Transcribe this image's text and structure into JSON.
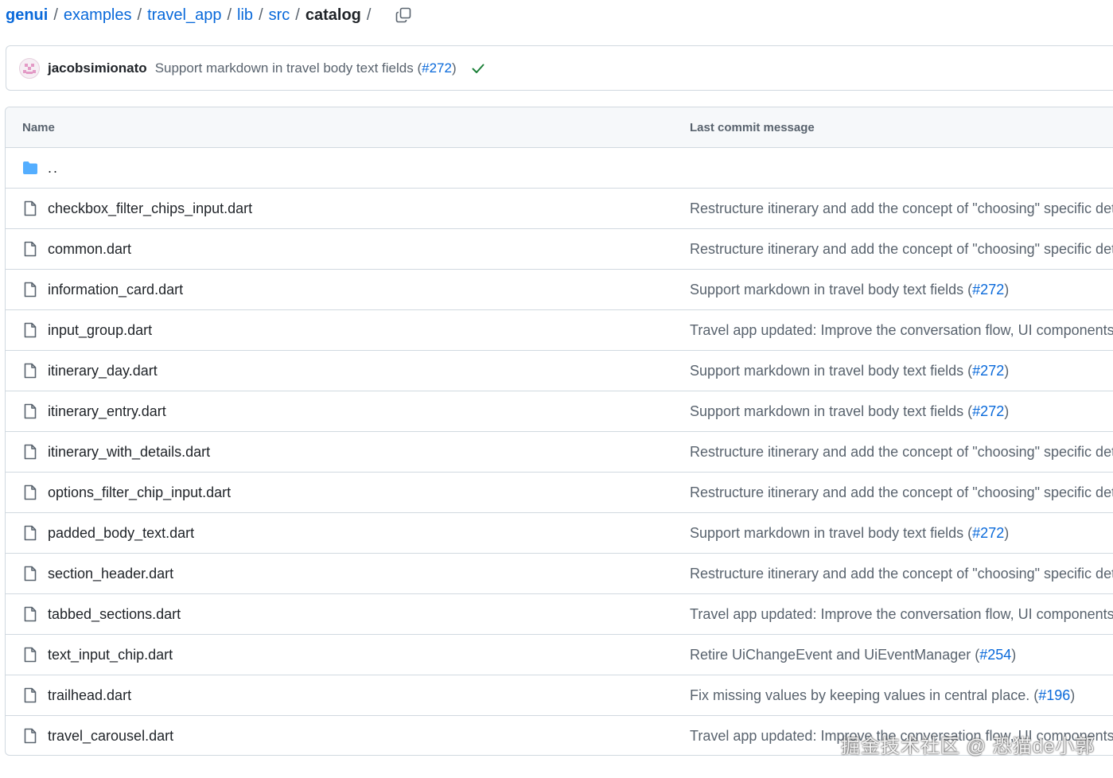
{
  "breadcrumb": {
    "root": "genui",
    "items": [
      "examples",
      "travel_app",
      "lib",
      "src"
    ],
    "current": "catalog",
    "separator": "/"
  },
  "commit": {
    "author": "jacobsimionato",
    "message": "Support markdown in travel body text fields (",
    "pr": "#272",
    "close": ")",
    "status_icon": "check-icon"
  },
  "table": {
    "col_name": "Name",
    "col_message": "Last commit message",
    "parent": "..",
    "rows": [
      {
        "name": "checkbox_filter_chips_input.dart",
        "msg": "Restructure itinerary and add the concept of \"choosing\" specific deta",
        "pr": "",
        "close": ""
      },
      {
        "name": "common.dart",
        "msg": "Restructure itinerary and add the concept of \"choosing\" specific deta",
        "pr": "",
        "close": ""
      },
      {
        "name": "information_card.dart",
        "msg": "Support markdown in travel body text fields (",
        "pr": "#272",
        "close": ")"
      },
      {
        "name": "input_group.dart",
        "msg": "Travel app updated: Improve the conversation flow, UI components, a",
        "pr": "",
        "close": ""
      },
      {
        "name": "itinerary_day.dart",
        "msg": "Support markdown in travel body text fields (",
        "pr": "#272",
        "close": ")"
      },
      {
        "name": "itinerary_entry.dart",
        "msg": "Support markdown in travel body text fields (",
        "pr": "#272",
        "close": ")"
      },
      {
        "name": "itinerary_with_details.dart",
        "msg": "Restructure itinerary and add the concept of \"choosing\" specific deta",
        "pr": "",
        "close": ""
      },
      {
        "name": "options_filter_chip_input.dart",
        "msg": "Restructure itinerary and add the concept of \"choosing\" specific deta",
        "pr": "",
        "close": ""
      },
      {
        "name": "padded_body_text.dart",
        "msg": "Support markdown in travel body text fields (",
        "pr": "#272",
        "close": ")"
      },
      {
        "name": "section_header.dart",
        "msg": "Restructure itinerary and add the concept of \"choosing\" specific deta",
        "pr": "",
        "close": ""
      },
      {
        "name": "tabbed_sections.dart",
        "msg": "Travel app updated: Improve the conversation flow, UI components, a",
        "pr": "",
        "close": ""
      },
      {
        "name": "text_input_chip.dart",
        "msg": "Retire UiChangeEvent and UiEventManager (",
        "pr": "#254",
        "close": ")"
      },
      {
        "name": "trailhead.dart",
        "msg": "Fix missing values by keeping values in central place. (",
        "pr": "#196",
        "close": ")"
      },
      {
        "name": "travel_carousel.dart",
        "msg": "Travel app updated: Improve the conversation flow, UI components, a",
        "pr": "",
        "close": ""
      }
    ]
  },
  "watermark": "掘金技术社区 @ 恐猫de小郭",
  "colors": {
    "link": "#0969da",
    "muted": "#59636e",
    "border": "#d1d9e0",
    "folder": "#54aeff",
    "success": "#1a7f37"
  }
}
